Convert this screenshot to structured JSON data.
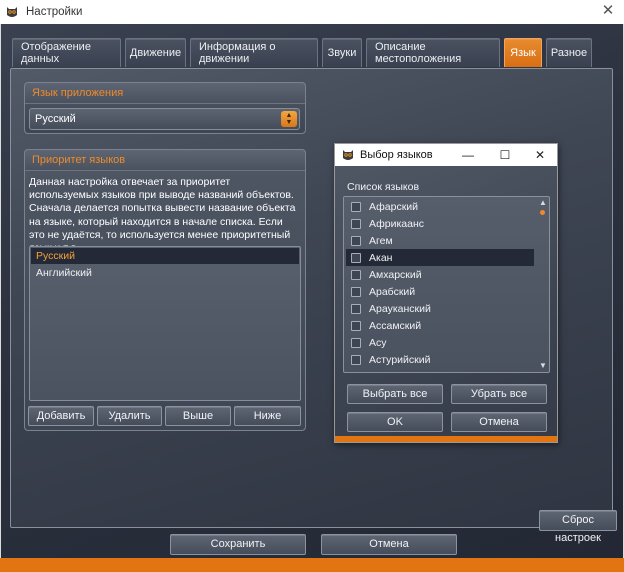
{
  "window": {
    "title": "Настройки"
  },
  "tabs": [
    {
      "label": "Отображение данных"
    },
    {
      "label": "Движение"
    },
    {
      "label": "Информация о движении"
    },
    {
      "label": "Звуки"
    },
    {
      "label": "Описание местоположения"
    },
    {
      "label": "Язык",
      "active": true
    },
    {
      "label": "Разное"
    }
  ],
  "app_language": {
    "header": "Язык приложения",
    "selected": "Русский"
  },
  "priority": {
    "header": "Приоритет языков",
    "description": "Данная настройка отвечает за приоритет используемых языков при выводе названий объектов. Сначала делается попытка вывести название объекта на языке, который находится в начале списка. Если это не удаётся, то используется менее приоритетный язык и т.д.",
    "items": [
      "Русский",
      "Английский"
    ],
    "selected_index": 0,
    "buttons": {
      "add": "Добавить",
      "remove": "Удалить",
      "up": "Выше",
      "down": "Ниже"
    }
  },
  "dialog": {
    "title": "Выбор языков",
    "list_label": "Список языков",
    "languages": [
      "Афарский",
      "Африкаанс",
      "Агем",
      "Акан",
      "Амхарский",
      "Арабский",
      "Арауканский",
      "Ассамский",
      "Асу",
      "Астурийский"
    ],
    "selected_index": 3,
    "select_all": "Выбрать все",
    "deselect_all": "Убрать все",
    "ok": "OK",
    "cancel": "Отмена"
  },
  "footer": {
    "reset": "Сброс настроек",
    "save": "Сохранить",
    "cancel": "Отмена"
  },
  "colors": {
    "accent": "#e27412",
    "header_text": "#f08a2a"
  }
}
